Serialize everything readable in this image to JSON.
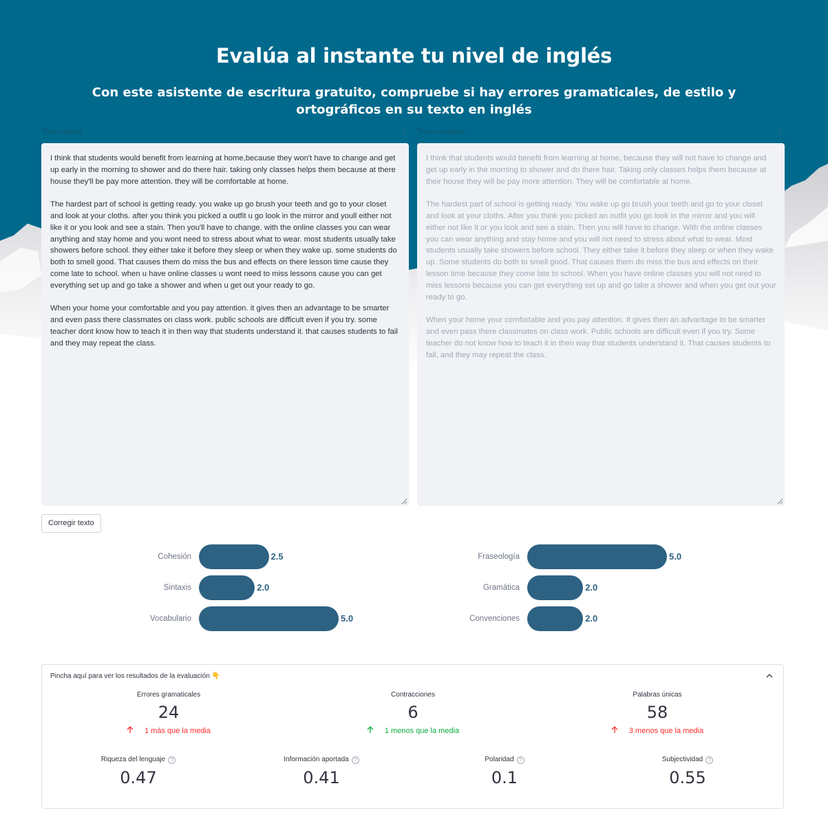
{
  "header": {
    "title": "Evalúa al instante tu nivel de inglés",
    "subtitle": "Con este asistente de escritura gratuito, compruebe si hay errores gramaticales, de estilo y ortográficos en su texto en inglés"
  },
  "input_area": {
    "label": "Texto original",
    "paragraphs": [
      "I think that students would benefit from learning at home,because they won't have to change and get up early in the morning to shower and do there hair. taking only classes helps them because at there house they'll be pay more attention. they will be comfortable at home.",
      "The hardest part of school is getting ready. you wake up go brush your teeth and go to your closet and look at your cloths. after you think you picked a outfit u go look in the mirror and youll either not like it or you look and see a stain. Then you'll have to change. with the online classes you can wear anything and stay home and you wont need to stress about what to wear. most students usually take showers before school. they either take it before they sleep or when they wake up. some students do both to smell good. That causes them do miss the bus and effects on there lesson time cause they come late to school. when u have online classes u wont need to miss lessons cause you can get everything set up and go take a shower and when u get out your ready to go.",
      "When your home your comfortable and you pay attention. it gives then an advantage to be smarter and even pass there classmates on class work. public schools are difficult even if you try. some teacher dont know how to teach it in then way that students understand it. that causes students to fail and they may repeat the class."
    ]
  },
  "output_area": {
    "label": "Texto corregido",
    "paragraphs": [
      "I think that students would benefit from learning at home, because they will not have to change and get up early in the morning to shower and do there hair. Taking only classes helps them because at their house they will be pay more attention. They will be comfortable at home.",
      "The hardest part of school is getting ready. You wake up go brush your teeth and go to your closet and look at your cloths. After you think you picked an outfit you go look in the mirror and you will either not like it or you look and see a stain. Then you will have to change. With the online classes you can wear anything and stay home and you will not need to stress about what to wear. Most students usually take showers before school. They either take it before they sleep or when they wake up. Some students do both to smell good. That causes them do miss the bus and effects on their lesson time because they come late to school. When you have online classes you will not need to miss lessons because you can get everything set up and go take a shower and when you get out your ready to go.",
      "When your home your comfortable and you pay attention. It gives then an advantage to be smarter and even pass there classmates on class work. Public schools are difficult even if you try. Some teacher do not know how to teach it in then way that students understand it. That causes students to fail, and they may repeat the class."
    ]
  },
  "correct_button": {
    "label": "Corregir texto"
  },
  "chart_data": [
    {
      "type": "bar",
      "orientation": "horizontal",
      "categories": [
        "Cohesión",
        "Sintaxis",
        "Vocabulario"
      ],
      "values": [
        2.5,
        2.0,
        5.0
      ],
      "value_labels": [
        "2.5",
        "2.0",
        "5.0"
      ],
      "xlim": [
        0,
        5
      ],
      "color": "#2d6283"
    },
    {
      "type": "bar",
      "orientation": "horizontal",
      "categories": [
        "Fraseología",
        "Gramática",
        "Convenciones"
      ],
      "values": [
        5.0,
        2.0,
        2.0
      ],
      "value_labels": [
        "5.0",
        "2.0",
        "2.0"
      ],
      "xlim": [
        0,
        5
      ],
      "color": "#2d6283"
    }
  ],
  "results": {
    "header": "Pincha aquí para ver los resultados de la evaluación 👇",
    "metrics_row1": [
      {
        "label": "Errores gramaticales",
        "value": "24",
        "delta": "1 más que la media",
        "delta_direction": "up",
        "delta_color": "#ff2b2b"
      },
      {
        "label": "Contracciones",
        "value": "6",
        "delta": "1 menos que la media",
        "delta_direction": "up",
        "delta_color": "#09ab3b"
      },
      {
        "label": "Palabras únicas",
        "value": "58",
        "delta": "3 menos que la media",
        "delta_direction": "up",
        "delta_color": "#ff2b2b"
      }
    ],
    "metrics_row2": [
      {
        "label": "Riqueza del lenguaje",
        "value": "0.47",
        "help": "?"
      },
      {
        "label": "Información aportada",
        "value": "0.41",
        "help": "?"
      },
      {
        "label": "Polaridad",
        "value": "0.1",
        "help": "?"
      },
      {
        "label": "Subjectividad",
        "value": "0.55",
        "help": "?"
      }
    ]
  },
  "colors": {
    "header_bg": "#00698c",
    "bar": "#2d6283",
    "textarea_bg": "#f0f2f6",
    "delta_red": "#ff2b2b",
    "delta_green": "#09ab3b"
  }
}
